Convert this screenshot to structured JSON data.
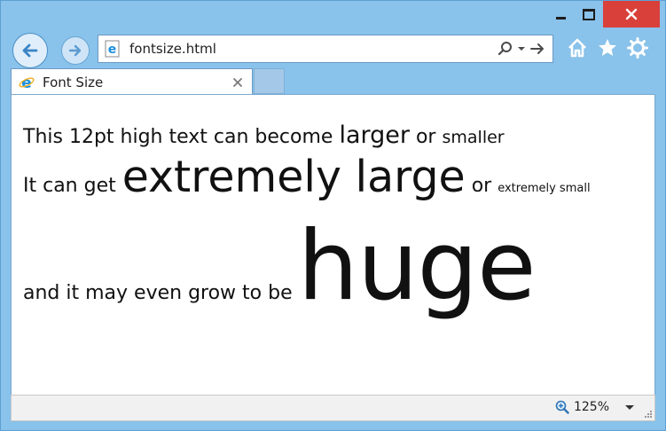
{
  "browser": {
    "address_url": "fontsize.html",
    "tab_title": "Font Size",
    "zoom_level": "125%"
  },
  "content": {
    "line1": {
      "part1": "This 12pt high text can become",
      "larger": "larger",
      "part2": "or",
      "smaller": "smaller"
    },
    "line2": {
      "part1": "It can get",
      "extremely_large": "extremely large",
      "part2": "or",
      "extremely_small": "extremely small"
    },
    "line3": {
      "part1": "and it may even grow to be",
      "huge": "huge"
    }
  },
  "icons": {
    "back": "back-arrow-icon",
    "forward": "forward-arrow-icon",
    "page": "ie-page-icon",
    "search": "search-icon",
    "refresh": "go-arrow-icon",
    "home": "home-icon",
    "favorites": "star-icon",
    "tools": "gear-icon",
    "zoom": "zoom-icon"
  },
  "colors": {
    "frame": "#89c2ea",
    "close_button": "#d9403a",
    "ie_logo": "#1b8fdc"
  }
}
